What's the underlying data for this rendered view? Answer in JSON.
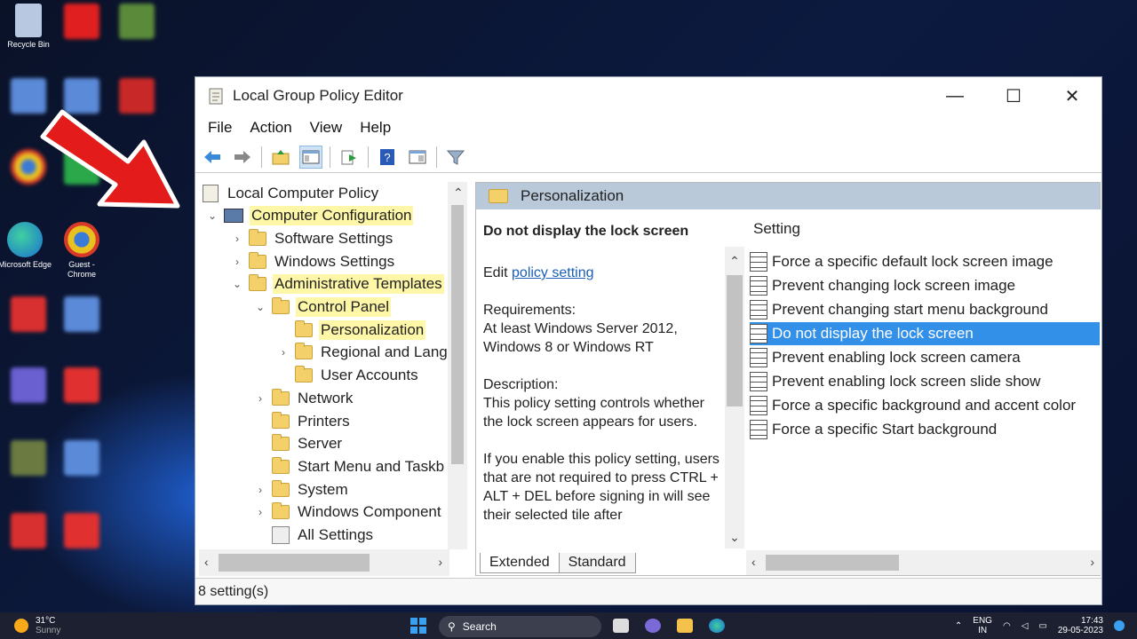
{
  "desktop": {
    "icons": [
      {
        "label": "Recycle Bin",
        "color": "#8fb0d8",
        "clear": true
      },
      {
        "label": "Microsoft Edge",
        "color": "#1f8fd8",
        "clear": true
      },
      {
        "label": "Guest - Chrome",
        "color": "#e0a020",
        "clear": true
      }
    ]
  },
  "window": {
    "title": "Local Group Policy Editor",
    "controls": {
      "minimize": "—",
      "maximize": "☐",
      "close": "✕"
    },
    "menu": [
      "File",
      "Action",
      "View",
      "Help"
    ],
    "tree": [
      {
        "label": "Local Computer Policy",
        "level": 0,
        "twisty": "",
        "hl": false,
        "root": true
      },
      {
        "label": "Computer Configuration",
        "level": 0,
        "twisty": "⌄",
        "hl": true
      },
      {
        "label": "Software Settings",
        "level": 1,
        "twisty": "›",
        "hl": false
      },
      {
        "label": "Windows Settings",
        "level": 1,
        "twisty": "›",
        "hl": false
      },
      {
        "label": "Administrative Templates",
        "level": 1,
        "twisty": "⌄",
        "hl": true
      },
      {
        "label": "Control Panel",
        "level": 2,
        "twisty": "⌄",
        "hl": true
      },
      {
        "label": "Personalization",
        "level": 3,
        "twisty": "",
        "hl": true
      },
      {
        "label": "Regional and Lang",
        "level": 3,
        "twisty": "›",
        "hl": false
      },
      {
        "label": "User Accounts",
        "level": 3,
        "twisty": "",
        "hl": false
      },
      {
        "label": "Network",
        "level": 2,
        "twisty": "›",
        "hl": false
      },
      {
        "label": "Printers",
        "level": 2,
        "twisty": "",
        "hl": false
      },
      {
        "label": "Server",
        "level": 2,
        "twisty": "",
        "hl": false
      },
      {
        "label": "Start Menu and Taskb",
        "level": 2,
        "twisty": "",
        "hl": false
      },
      {
        "label": "System",
        "level": 2,
        "twisty": "›",
        "hl": false
      },
      {
        "label": "Windows Component",
        "level": 2,
        "twisty": "›",
        "hl": false
      },
      {
        "label": "All Settings",
        "level": 2,
        "twisty": "",
        "hl": false
      }
    ],
    "right_header": "Personalization",
    "description": {
      "title": "Do not display the lock screen",
      "edit_prefix": "Edit ",
      "edit_link": "policy setting",
      "requirements_label": "Requirements:",
      "requirements": "At least Windows Server 2012, Windows 8 or Windows RT",
      "description_label": "Description:",
      "description": "This policy setting controls whether the lock screen appears for users.",
      "more": "If you enable this policy setting, users that are not required to press CTRL + ALT + DEL before signing in will see their selected tile after"
    },
    "list_header": "Setting",
    "settings": [
      {
        "label": "Force a specific default lock screen image",
        "selected": false
      },
      {
        "label": "Prevent changing lock screen image",
        "selected": false
      },
      {
        "label": "Prevent changing start menu background",
        "selected": false
      },
      {
        "label": "Do not display the lock screen",
        "selected": true
      },
      {
        "label": "Prevent enabling lock screen camera",
        "selected": false
      },
      {
        "label": "Prevent enabling lock screen slide show",
        "selected": false
      },
      {
        "label": "Force a specific background and accent color",
        "selected": false
      },
      {
        "label": "Force a specific Start background",
        "selected": false
      }
    ],
    "tabs": [
      "Extended",
      "Standard"
    ],
    "status": "8 setting(s)"
  },
  "taskbar": {
    "weather_temp": "31°C",
    "weather_desc": "Sunny",
    "search_placeholder": "Search",
    "lang": "ENG",
    "region": "IN",
    "time": "17:43",
    "date": "29-05-2023"
  }
}
